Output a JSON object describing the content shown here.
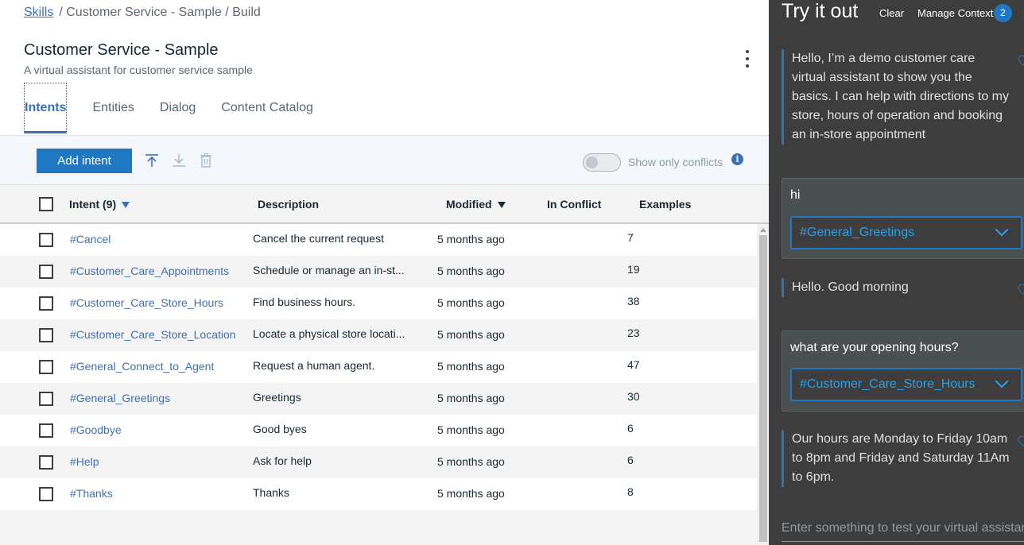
{
  "breadcrumb": {
    "root": "Skills",
    "path": "/ Customer Service - Sample / Build"
  },
  "page": {
    "title": "Customer Service - Sample",
    "subtitle": "A virtual assistant for customer service sample"
  },
  "tabs": [
    {
      "label": "Intents",
      "active": true
    },
    {
      "label": "Entities",
      "active": false
    },
    {
      "label": "Dialog",
      "active": false
    },
    {
      "label": "Content Catalog",
      "active": false
    }
  ],
  "toolbar": {
    "add_label": "Add intent",
    "icons": [
      "upload-icon",
      "download-icon",
      "trash-icon"
    ],
    "toggle_label": "Show only conflicts",
    "toggle_on": false
  },
  "table": {
    "headers": {
      "intent": "Intent (9)",
      "description": "Description",
      "modified": "Modified",
      "conflict": "In Conflict",
      "examples": "Examples"
    },
    "rows": [
      {
        "name": "#Cancel",
        "description": "Cancel the current request",
        "modified": "5 months ago",
        "examples": "7"
      },
      {
        "name": "#Customer_Care_Appointments",
        "description": "Schedule or manage an in-st...",
        "modified": "5 months ago",
        "examples": "19"
      },
      {
        "name": "#Customer_Care_Store_Hours",
        "description": "Find business hours.",
        "modified": "5 months ago",
        "examples": "38"
      },
      {
        "name": "#Customer_Care_Store_Location",
        "description": "Locate a physical store locati...",
        "modified": "5 months ago",
        "examples": "23"
      },
      {
        "name": "#General_Connect_to_Agent",
        "description": "Request a human agent.",
        "modified": "5 months ago",
        "examples": "47"
      },
      {
        "name": "#General_Greetings",
        "description": "Greetings",
        "modified": "5 months ago",
        "examples": "30"
      },
      {
        "name": "#Goodbye",
        "description": "Good byes",
        "modified": "5 months ago",
        "examples": "6"
      },
      {
        "name": "#Help",
        "description": "Ask for help",
        "modified": "5 months ago",
        "examples": "6"
      },
      {
        "name": "#Thanks",
        "description": "Thanks",
        "modified": "5 months ago",
        "examples": "8"
      }
    ]
  },
  "tryit": {
    "title": "Try it out",
    "clear": "Clear",
    "manage_context": "Manage Context",
    "context_count": "2",
    "bot_messages": [
      "Hello, I’m a demo customer care virtual assistant to show you the basics. I can help with directions to my store, hours of operation and booking an in-store appointment",
      "Hello. Good morning",
      "Our hours are Monday to Friday 10am to 8pm and Friday and Saturday 11Am to 6pm."
    ],
    "user_messages": [
      {
        "text": "hi",
        "intent": "#General_Greetings"
      },
      {
        "text": "what are your opening hours?",
        "intent": "#Customer_Care_Store_Hours"
      }
    ],
    "input_placeholder": "Enter something to test your virtual assistant"
  },
  "colors": {
    "accent": "#1f78c1",
    "link": "#3d70b2",
    "panel_bg": "#3d3d3d"
  }
}
